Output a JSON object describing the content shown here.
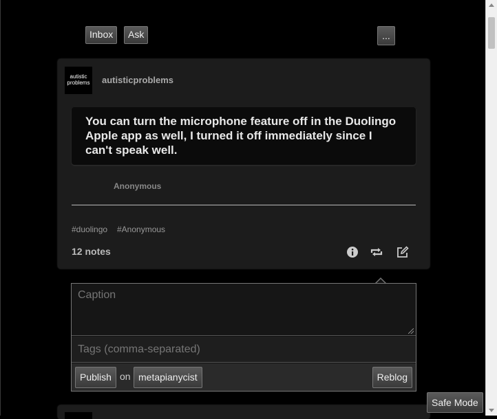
{
  "nav": {
    "inbox": "Inbox",
    "ask": "Ask",
    "more": "..."
  },
  "post": {
    "avatar_text": "autistic problems",
    "blog_name": "autisticproblems",
    "question": "You can turn the microphone feature off in the Duolingo Apple app as well, I turned it off immediately since I can't speak well.",
    "asker": "Anonymous",
    "tags": [
      "#duolingo",
      "#Anonymous"
    ],
    "notes": "12 notes",
    "icons": [
      "info-icon",
      "reblog-icon",
      "edit-icon"
    ]
  },
  "reblog_form": {
    "caption_placeholder": "Caption",
    "tags_placeholder": "Tags (comma-separated)",
    "publish": "Publish",
    "on": "on",
    "blog": "metapianycist",
    "reblog": "Reblog"
  },
  "safe_mode": "Safe Mode",
  "colors": {
    "background": "#000000",
    "card": "#1c1c1c",
    "button": "#4a4a4a"
  }
}
